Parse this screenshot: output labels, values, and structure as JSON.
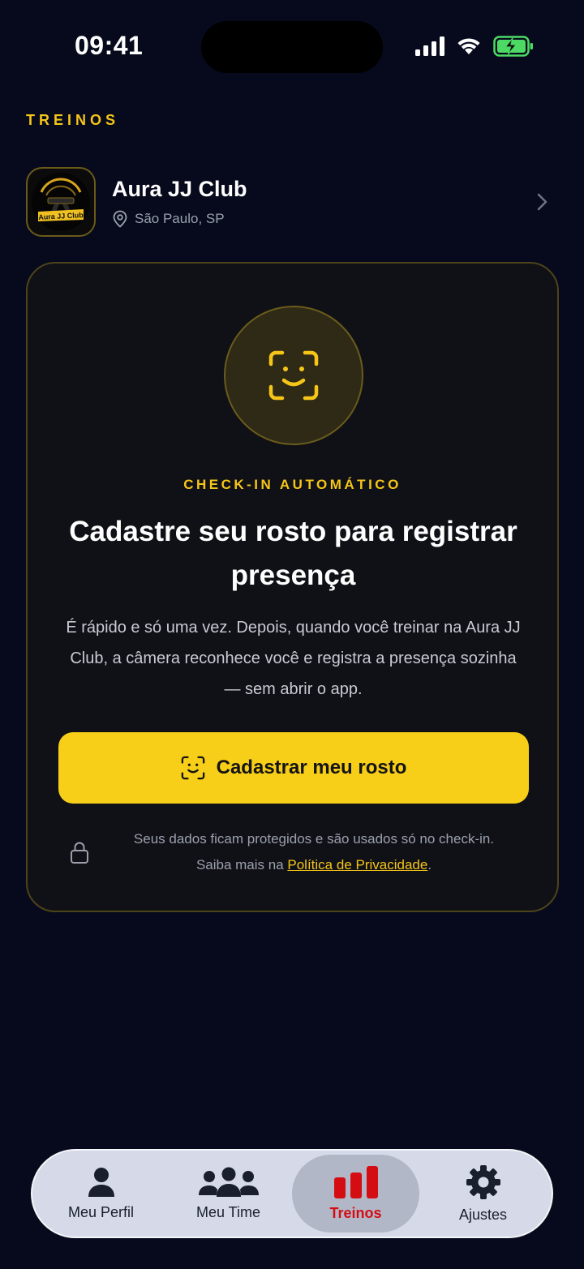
{
  "status_bar": {
    "time": "09:41",
    "icons": [
      "cellular-signal-icon",
      "wifi-icon",
      "battery-charging-icon"
    ],
    "battery_color": "#4cd964"
  },
  "section": {
    "label": "TREINOS"
  },
  "club": {
    "name": "Aura JJ Club",
    "location": "São Paulo, SP",
    "logo_text": "Aura JJ Club",
    "icons": {
      "location": "location-pin-icon",
      "chevron": "chevron-right-icon"
    }
  },
  "card": {
    "icon": "face-id-icon",
    "eyebrow": "CHECK-IN AUTOMÁTICO",
    "title": "Cadastre seu rosto para registrar presença",
    "description": "É rápido e só uma vez. Depois, quando você treinar na Aura JJ Club, a câmera reconhece você e registra a presença sozinha — sem abrir o app.",
    "cta_label": "Cadastrar meu rosto",
    "privacy_line1": "Seus dados ficam protegidos e são usados só no check-in.",
    "privacy_line2_prefix": "Saiba mais na ",
    "privacy_link": "Política de Privacidade",
    "privacy_line2_suffix": "."
  },
  "tabs": [
    {
      "label": "Meu Perfil",
      "icon": "person-icon",
      "active": false
    },
    {
      "label": "Meu Time",
      "icon": "team-icon",
      "active": false
    },
    {
      "label": "Treinos",
      "icon": "bar-chart-icon",
      "active": true
    },
    {
      "label": "Ajustes",
      "icon": "gear-icon",
      "active": false
    }
  ],
  "colors": {
    "background": "#060a1c",
    "accent": "#f5c518",
    "cta": "#f7ce18",
    "active_tab": "#d40d12",
    "tabbar": "#d6dae8"
  }
}
